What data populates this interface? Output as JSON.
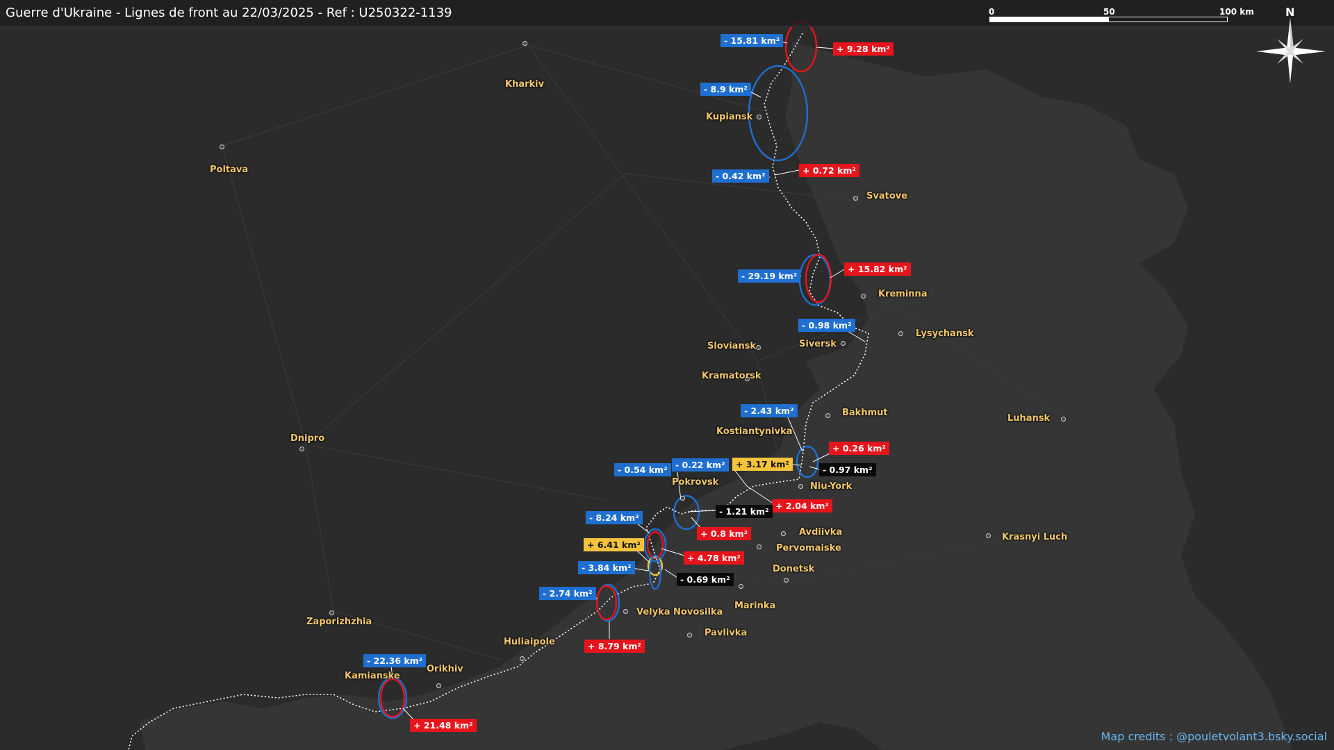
{
  "title": "Guerre d'Ukraine - Lignes de front au 22/03/2025 - Ref : U250322-1139",
  "scale": {
    "ticks": [
      "0",
      "50",
      "100 km"
    ]
  },
  "compass": {
    "label": "N"
  },
  "credits": "Map credits : @pouletvolant3.bsky.social",
  "colors": {
    "gain_red": "#e8141b",
    "loss_blue": "#1f6fd1",
    "yellow": "#f6c33c",
    "black": "#0a0a0a",
    "city": "#f2c76b"
  },
  "cities": [
    {
      "name": "Kharkiv"
    },
    {
      "name": "Kupiansk"
    },
    {
      "name": "Poltava"
    },
    {
      "name": "Svatove"
    },
    {
      "name": "Kreminna"
    },
    {
      "name": "Lysychansk"
    },
    {
      "name": "Siversk"
    },
    {
      "name": "Sloviansk"
    },
    {
      "name": "Kramatorsk"
    },
    {
      "name": "Bakhmut"
    },
    {
      "name": "Kostiantynivka"
    },
    {
      "name": "Luhansk"
    },
    {
      "name": "Dnipro"
    },
    {
      "name": "Pokrovsk"
    },
    {
      "name": "Niu-York"
    },
    {
      "name": "Avdiivka"
    },
    {
      "name": "Pervomaiske"
    },
    {
      "name": "Donetsk"
    },
    {
      "name": "Krasnyi Luch"
    },
    {
      "name": "Marinka"
    },
    {
      "name": "Velyka Novosilka"
    },
    {
      "name": "Pavlivka"
    },
    {
      "name": "Zaporizhzhia"
    },
    {
      "name": "Huliaipole"
    },
    {
      "name": "Orikhiv"
    },
    {
      "name": "Kamianske"
    }
  ],
  "labels": [
    {
      "text": "- 15.81 km²",
      "kind": "blue"
    },
    {
      "text": "+ 9.28 km²",
      "kind": "red"
    },
    {
      "text": "- 8.9 km²",
      "kind": "blue"
    },
    {
      "text": "- 0.42 km²",
      "kind": "blue"
    },
    {
      "text": "+ 0.72 km²",
      "kind": "red"
    },
    {
      "text": "- 29.19 km²",
      "kind": "blue"
    },
    {
      "text": "+ 15.82 km²",
      "kind": "red"
    },
    {
      "text": "- 0.98 km²",
      "kind": "blue"
    },
    {
      "text": "- 2.43 km²",
      "kind": "blue"
    },
    {
      "text": "+ 0.26 km²",
      "kind": "red"
    },
    {
      "text": "- 0.97 km²",
      "kind": "black"
    },
    {
      "text": "+ 3.17 km²",
      "kind": "yellow"
    },
    {
      "text": "- 0.22 km²",
      "kind": "blue"
    },
    {
      "text": "- 0.54 km²",
      "kind": "blue"
    },
    {
      "text": "+ 2.04 km²",
      "kind": "red"
    },
    {
      "text": "- 1.21 km²",
      "kind": "black"
    },
    {
      "text": "+ 0.8 km²",
      "kind": "red"
    },
    {
      "text": "- 8.24 km²",
      "kind": "blue"
    },
    {
      "text": "+ 4.78 km²",
      "kind": "red"
    },
    {
      "text": "+ 6.41 km²",
      "kind": "yellow"
    },
    {
      "text": "- 3.84 km²",
      "kind": "blue"
    },
    {
      "text": "- 0.69 km²",
      "kind": "black"
    },
    {
      "text": "- 2.74 km²",
      "kind": "blue"
    },
    {
      "text": "+ 8.79 km²",
      "kind": "red"
    },
    {
      "text": "- 22.36 km²",
      "kind": "blue"
    },
    {
      "text": "+ 21.48 km²",
      "kind": "red"
    }
  ]
}
